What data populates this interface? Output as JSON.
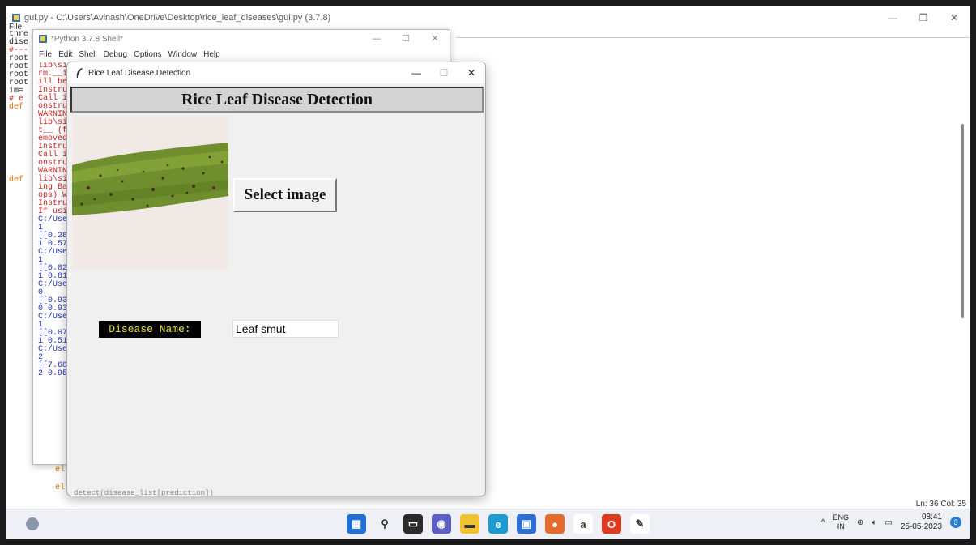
{
  "editor": {
    "title": "gui.py - C:\\Users\\Avinash\\OneDrive\\Desktop\\rice_leaf_diseases\\gui.py (3.7.8)",
    "menu_first": "File",
    "code_lines": [
      {
        "text": "thre",
        "cls": "dark"
      },
      {
        "text": "dise",
        "cls": "dark"
      },
      {
        "text": "#---",
        "cls": "red"
      },
      {
        "text": "root",
        "cls": "dark"
      },
      {
        "text": "root",
        "cls": "dark"
      },
      {
        "text": "root",
        "cls": "dark"
      },
      {
        "text": "root",
        "cls": "dark"
      },
      {
        "text": "im=",
        "cls": "dark"
      },
      {
        "text": "# e",
        "cls": "red"
      },
      {
        "text": "def",
        "cls": "orange"
      },
      {
        "text": "",
        "cls": "dark"
      },
      {
        "text": "",
        "cls": "dark"
      },
      {
        "text": "",
        "cls": "dark"
      },
      {
        "text": "",
        "cls": "dark"
      },
      {
        "text": "",
        "cls": "dark"
      },
      {
        "text": "",
        "cls": "dark"
      },
      {
        "text": "",
        "cls": "dark"
      },
      {
        "text": "",
        "cls": "dark"
      },
      {
        "text": "def",
        "cls": "orange"
      }
    ],
    "behind_lines": [
      "el",
      "el"
    ],
    "status": "Ln: 36  Col: 35"
  },
  "shell": {
    "title": "*Python 3.7.8 Shell*",
    "menu": [
      "File",
      "Edit",
      "Shell",
      "Debug",
      "Options",
      "Window",
      "Help"
    ],
    "lines": [
      {
        "text": "lib\\si",
        "cls": "red"
      },
      {
        "text": "rm.__i",
        "cls": "red"
      },
      {
        "text": "ill be",
        "cls": "red"
      },
      {
        "text": "Instru",
        "cls": "red"
      },
      {
        "text": "Call i",
        "cls": "red"
      },
      {
        "text": "onstru",
        "cls": "red"
      },
      {
        "text": "WARNIN",
        "cls": "red"
      },
      {
        "text": "lib\\si",
        "cls": "red"
      },
      {
        "text": "t__ (f",
        "cls": "red"
      },
      {
        "text": "emoved",
        "cls": "red"
      },
      {
        "text": "Instru",
        "cls": "red"
      },
      {
        "text": "Call i",
        "cls": "red"
      },
      {
        "text": "onstru",
        "cls": "red"
      },
      {
        "text": "WARNIN",
        "cls": "red"
      },
      {
        "text": "lib\\si",
        "cls": "red"
      },
      {
        "text": "ing Ba",
        "cls": "red"
      },
      {
        "text": "ops) W",
        "cls": "red"
      },
      {
        "text": "Instru",
        "cls": "red"
      },
      {
        "text": "If usi",
        "cls": "red"
      },
      {
        "text": "C:/Use",
        "cls": "blue"
      },
      {
        "text": "1",
        "cls": "blue"
      },
      {
        "text": "[[0.28",
        "cls": "blue"
      },
      {
        "text": "1 0.57",
        "cls": "blue"
      },
      {
        "text": "C:/Use",
        "cls": "blue"
      },
      {
        "text": "1",
        "cls": "blue"
      },
      {
        "text": "[[0.02",
        "cls": "blue"
      },
      {
        "text": "1 0.81",
        "cls": "blue"
      },
      {
        "text": "C:/Use",
        "cls": "blue"
      },
      {
        "text": "0",
        "cls": "blue"
      },
      {
        "text": "[[0.93",
        "cls": "blue"
      },
      {
        "text": "0 0.93",
        "cls": "blue"
      },
      {
        "text": "C:/Use",
        "cls": "blue"
      },
      {
        "text": "1",
        "cls": "blue"
      },
      {
        "text": "[[0.07",
        "cls": "blue"
      },
      {
        "text": "1 0.51",
        "cls": "blue"
      },
      {
        "text": "C:/Use",
        "cls": "blue"
      },
      {
        "text": "2",
        "cls": "blue"
      },
      {
        "text": "[[7.68",
        "cls": "blue"
      },
      {
        "text": "2 0.95",
        "cls": "blue"
      }
    ]
  },
  "app": {
    "window_title": "Rice Leaf Disease Detection",
    "heading": "Rice Leaf Disease Detection",
    "select_button": "Select image",
    "disease_label": "Disease Name:",
    "disease_value": "Leaf smut",
    "bottom_code": "detect(disease_list[prediction])"
  },
  "taskbar": {
    "lang_top": "ENG",
    "lang_bottom": "IN",
    "time": "08:41",
    "date": "25-05-2023",
    "notifications": "3",
    "icons": [
      {
        "name": "start-icon",
        "color": "#1f6fd6",
        "glyph": "▦"
      },
      {
        "name": "search-icon",
        "color": "#eef0f5",
        "glyph": "⚲"
      },
      {
        "name": "task-view-icon",
        "color": "#2b2b2b",
        "glyph": "▭"
      },
      {
        "name": "chat-icon",
        "color": "#5b5fc7",
        "glyph": "◉"
      },
      {
        "name": "file-explorer-icon",
        "color": "#f2c12e",
        "glyph": "▬"
      },
      {
        "name": "edge-icon",
        "color": "#1b9bd1",
        "glyph": "e"
      },
      {
        "name": "store-icon",
        "color": "#2c6ed5",
        "glyph": "▣"
      },
      {
        "name": "firefox-icon",
        "color": "#e66a2c",
        "glyph": "●"
      },
      {
        "name": "amazon-icon",
        "color": "#ffffff",
        "glyph": "a"
      },
      {
        "name": "office-icon",
        "color": "#e03a1e",
        "glyph": "O"
      },
      {
        "name": "python-idle-icon",
        "color": "#ffffff",
        "glyph": "✎"
      }
    ]
  }
}
